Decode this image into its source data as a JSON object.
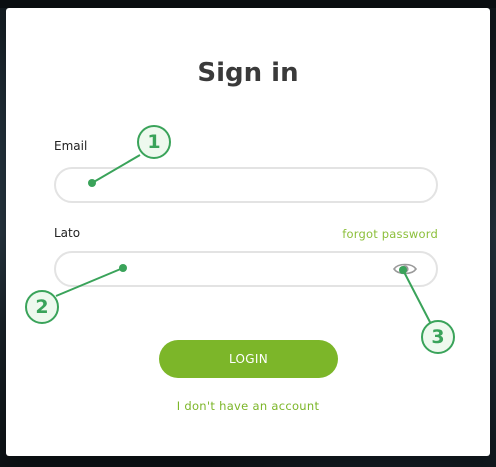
{
  "modal": {
    "title": "Sign in",
    "email_label": "Email",
    "email_value": "",
    "password_label": "Lato",
    "password_value": "",
    "forgot_password": "forgot password",
    "login_button": "LOGIN",
    "no_account_link": "I don't have an account"
  },
  "annotations": {
    "callout_1": "1",
    "callout_2": "2",
    "callout_3": "3"
  },
  "colors": {
    "accent": "#7cb629",
    "link": "#8cbf3a",
    "callout": "#3aa35a",
    "title": "#3a3a3a"
  },
  "icons": {
    "password_toggle": "eye-icon"
  }
}
